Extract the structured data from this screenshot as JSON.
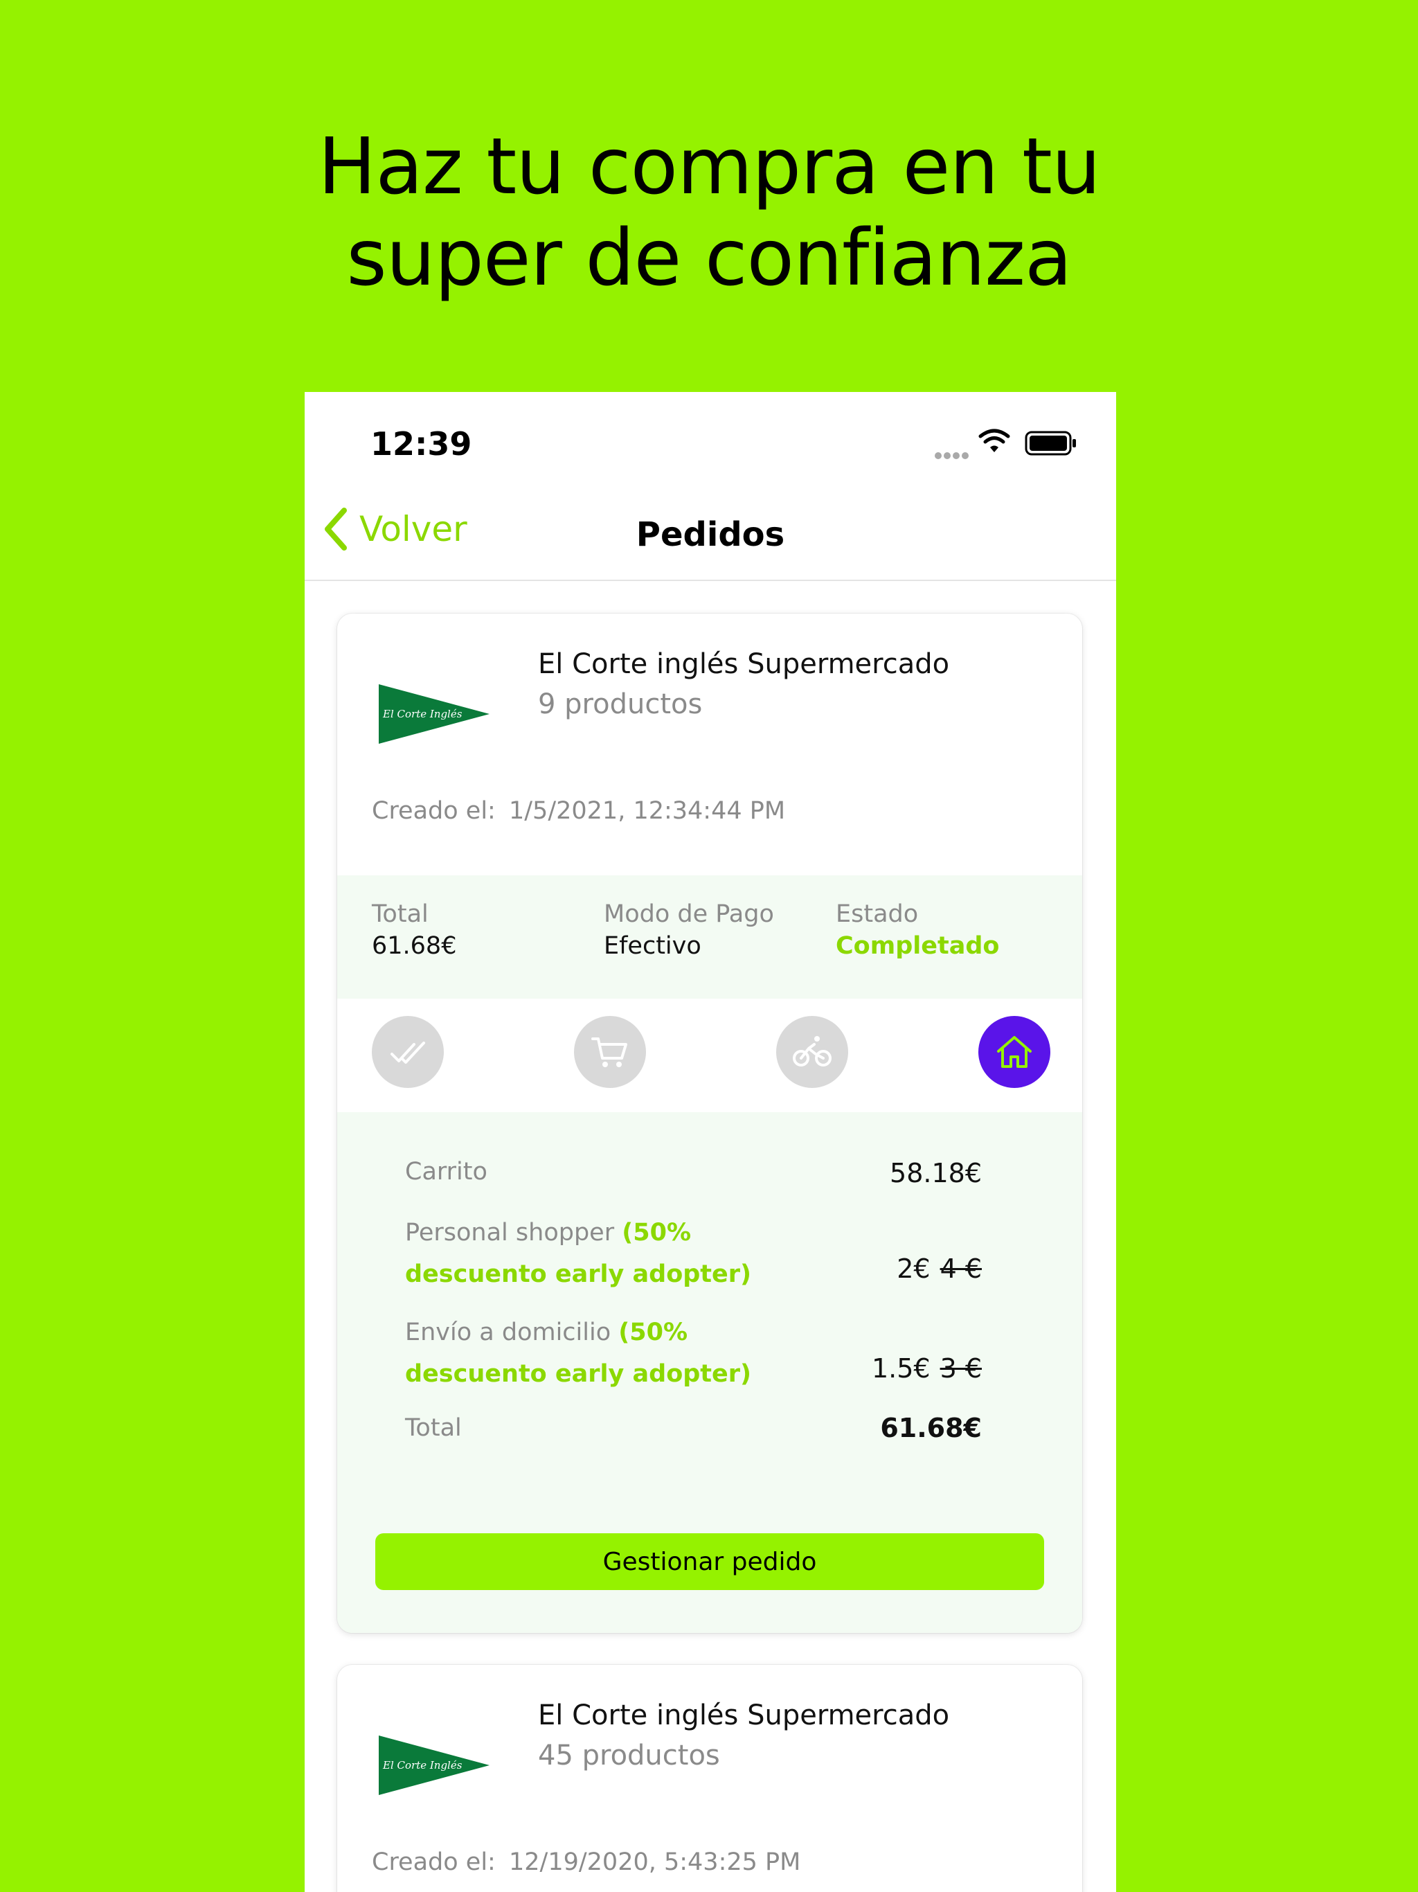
{
  "headline": {
    "line1": "Haz tu compra en tu",
    "line2": "super de confianza"
  },
  "status_bar": {
    "time": "12:39",
    "icons": [
      "signal-dots",
      "wifi-icon",
      "battery-icon"
    ]
  },
  "nav": {
    "back_label": "Volver",
    "title": "Pedidos"
  },
  "colors": {
    "background": "#95f200",
    "accent": "#8bd800",
    "active_step": "#5a14e9",
    "panel": "#f3fbf3"
  },
  "orders": [
    {
      "shop": "El Corte inglés Supermercado",
      "products": "9 productos",
      "created_label": "Creado el:",
      "created_value": "1/5/2021, 12:34:44 PM",
      "summary": {
        "total_label": "Total",
        "total_value": "61.68€",
        "payment_label": "Modo de Pago",
        "payment_value": "Efectivo",
        "status_label": "Estado",
        "status_value": "Completado"
      },
      "steps": [
        {
          "icon": "double-check-icon",
          "active": false
        },
        {
          "icon": "cart-icon",
          "active": false
        },
        {
          "icon": "bike-icon",
          "active": false
        },
        {
          "icon": "home-icon",
          "active": true
        }
      ],
      "breakdown": {
        "cart_label": "Carrito",
        "cart_value": "58.18€",
        "shopper_label": "Personal shopper",
        "shopper_promo": "(50% descuento early adopter)",
        "shopper_value": "2€",
        "shopper_old": "4 €",
        "delivery_label": "Envío a domicilio",
        "delivery_promo": "(50% descuento early adopter)",
        "delivery_value": "1.5€",
        "delivery_old": "3 €",
        "total_label": "Total",
        "total_value": "61.68€"
      },
      "manage_label": "Gestionar pedido"
    },
    {
      "shop": "El Corte inglés Supermercado",
      "products": "45 productos",
      "created_label": "Creado el:",
      "created_value": "12/19/2020, 5:43:25 PM"
    }
  ]
}
